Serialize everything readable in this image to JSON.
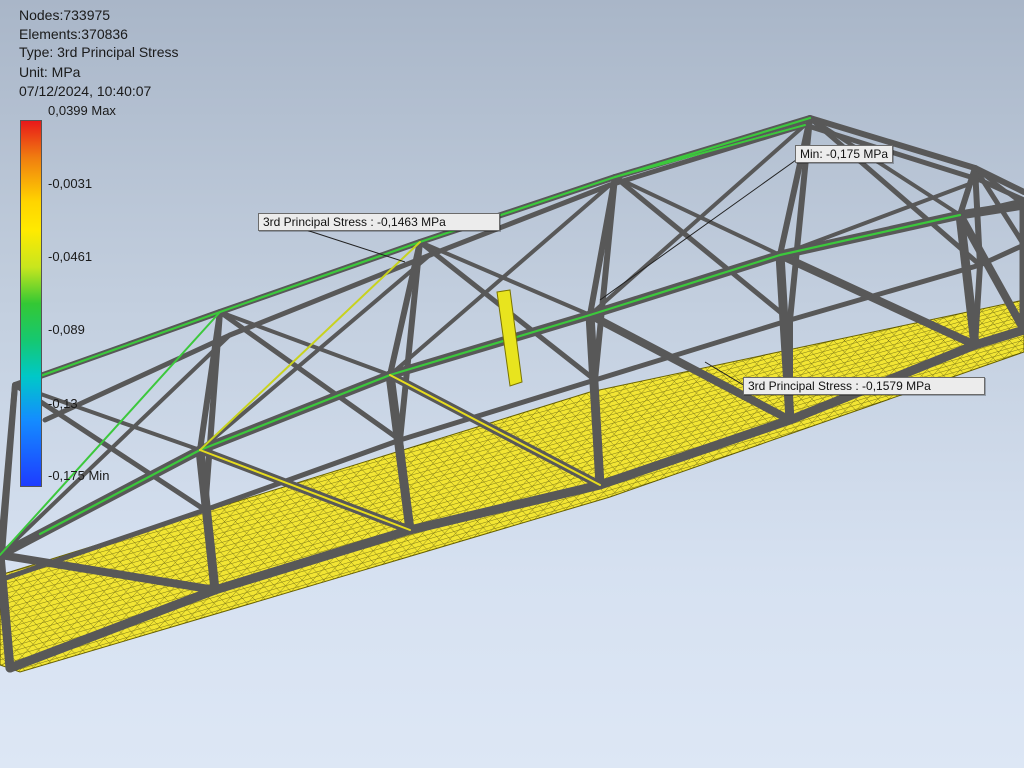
{
  "results_info": {
    "nodes": "Nodes:733975",
    "elements": "Elements:370836",
    "type": "Type: 3rd Principal Stress",
    "unit": "Unit: MPa",
    "timestamp": "07/12/2024, 10:40:07"
  },
  "legend": {
    "max_label": "0,0399 Max",
    "ticks": [
      "-0,0031",
      "-0,0461",
      "-0,089",
      "-0,13",
      "-0,175 Min"
    ],
    "colors": [
      "#e8191a",
      "#f07d10",
      "#ffea00",
      "#34c834",
      "#00c8c8",
      "#1e3cff"
    ]
  },
  "probes": {
    "min_label": "Min: -0,175 MPa",
    "probe_1": "3rd Principal Stress : -0,1463 MPa",
    "probe_2": "3rd Principal Stress : -0,1579 MPa"
  },
  "model": {
    "deck_color": "#f2e533",
    "frame_color": "#585858",
    "stress_highlight_color": "#3cc83c",
    "mesh_color": "#1b1b00"
  }
}
